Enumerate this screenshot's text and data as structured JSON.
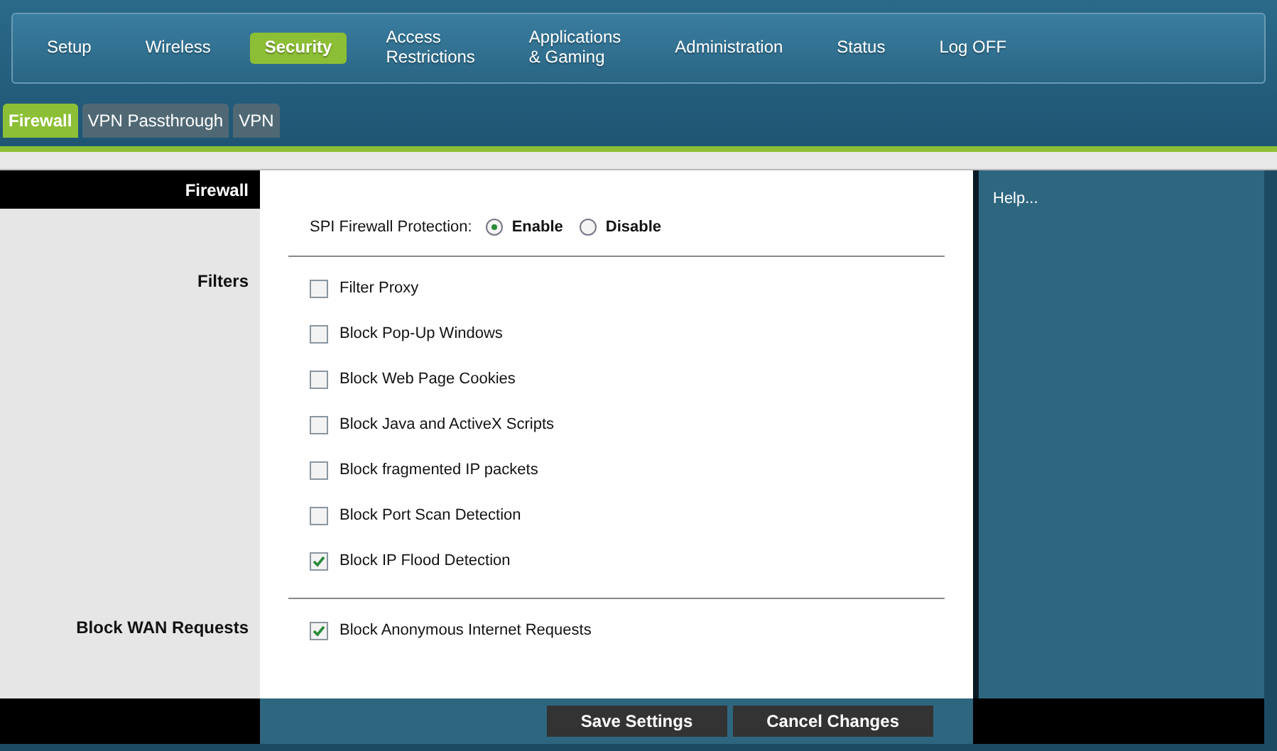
{
  "nav": [
    {
      "label": "Setup",
      "selected": false
    },
    {
      "label": "Wireless",
      "selected": false
    },
    {
      "label": "Security",
      "selected": true
    },
    {
      "label": "Access\nRestrictions",
      "selected": false
    },
    {
      "label": "Applications\n& Gaming",
      "selected": false
    },
    {
      "label": "Administration",
      "selected": false
    },
    {
      "label": "Status",
      "selected": false
    },
    {
      "label": "Log OFF",
      "selected": false
    }
  ],
  "subtabs": [
    {
      "label": "Firewall",
      "selected": true
    },
    {
      "label": "VPN Passthrough",
      "selected": false
    },
    {
      "label": "VPN",
      "selected": false
    }
  ],
  "section_header": "Firewall",
  "spi": {
    "label": "SPI Firewall Protection:",
    "options": [
      {
        "label": "Enable",
        "selected": true
      },
      {
        "label": "Disable",
        "selected": false
      }
    ]
  },
  "filters_label": "Filters",
  "filters": [
    {
      "label": "Filter Proxy",
      "checked": false
    },
    {
      "label": "Block Pop-Up Windows",
      "checked": false
    },
    {
      "label": "Block Web Page Cookies",
      "checked": false
    },
    {
      "label": "Block Java and ActiveX Scripts",
      "checked": false
    },
    {
      "label": "Block fragmented IP packets",
      "checked": false
    },
    {
      "label": "Block Port Scan Detection",
      "checked": false
    },
    {
      "label": "Block IP Flood Detection",
      "checked": true
    }
  ],
  "wan_label": "Block WAN Requests",
  "wan": [
    {
      "label": "Block Anonymous Internet Requests",
      "checked": true
    }
  ],
  "help": "Help...",
  "buttons": [
    "Save Settings",
    "Cancel Changes"
  ]
}
